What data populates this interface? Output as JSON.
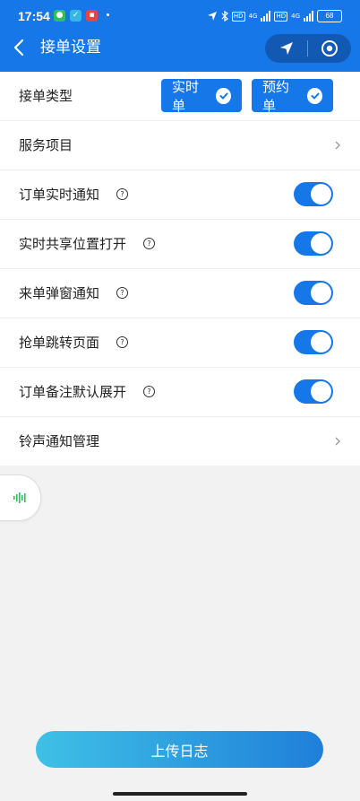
{
  "status_bar": {
    "time": "17:54",
    "battery": "68",
    "network_label": "4G",
    "hd_label": "HD"
  },
  "header": {
    "title": "接单设置",
    "back_icon": "chevron-left-icon",
    "capsule_icons": [
      "navigation-arrow-icon",
      "target-circle-icon"
    ]
  },
  "settings": {
    "order_type": {
      "label": "接单类型",
      "options": [
        "实时单",
        "预约单"
      ],
      "selected": [
        "实时单",
        "预约单"
      ]
    },
    "service_items": {
      "label": "服务项目"
    },
    "toggles": [
      {
        "label": "订单实时通知",
        "on": true
      },
      {
        "label": "实时共享位置打开",
        "on": true
      },
      {
        "label": "来单弹窗通知",
        "on": true
      },
      {
        "label": "抢单跳转页面",
        "on": true
      },
      {
        "label": "订单备注默认展开",
        "on": true
      }
    ],
    "ringtone": {
      "label": "铃声通知管理"
    }
  },
  "floating": {
    "icon": "audio-wave-icon",
    "color": "#2fbf5f"
  },
  "upload_button": {
    "label": "上传日志"
  },
  "colors": {
    "primary": "#1677e8",
    "background": "#f2f2f2",
    "gradient_start": "#3fc1e6",
    "gradient_end": "#1f7fd9"
  }
}
